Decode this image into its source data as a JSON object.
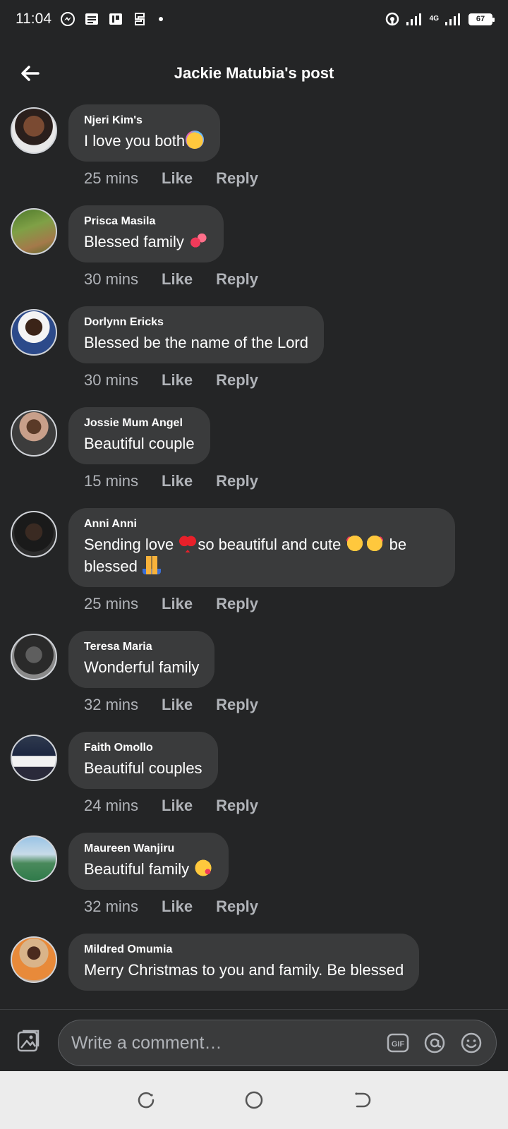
{
  "status_bar": {
    "time": "11:04",
    "network": "4G",
    "battery": "67",
    "icons": [
      "messenger-icon",
      "news-icon",
      "pdf-icon",
      "app-icon",
      "hotspot-icon",
      "signal-icon"
    ]
  },
  "header": {
    "title": "Jackie Matubia's post"
  },
  "comments": [
    {
      "author": "Njeri Kim's",
      "text": "I love you both",
      "emojis": [
        "party-face"
      ],
      "time": "25 mins",
      "like": "Like",
      "reply": "Reply"
    },
    {
      "author": "Prisca Masila",
      "text": "Blessed family ",
      "emojis": [
        "two-hearts"
      ],
      "time": "30 mins",
      "like": "Like",
      "reply": "Reply"
    },
    {
      "author": "Dorlynn Ericks",
      "text": "Blessed be the name of the Lord",
      "emojis": [],
      "time": "30 mins",
      "like": "Like",
      "reply": "Reply"
    },
    {
      "author": "Jossie Mum Angel",
      "text": "Beautiful couple",
      "emojis": [],
      "time": "15 mins",
      "like": "Like",
      "reply": "Reply"
    },
    {
      "author": "Anni Anni",
      "text_line1_a": "Sending love ",
      "text_line1_b": "so beautiful and cute ",
      "text_line1_c": " be",
      "text_line2": "blessed ",
      "time": "25 mins",
      "like": "Like",
      "reply": "Reply"
    },
    {
      "author": "Teresa Maria",
      "text": "Wonderful family",
      "emojis": [],
      "time": "32 mins",
      "like": "Like",
      "reply": "Reply"
    },
    {
      "author": "Faith Omollo",
      "text": "Beautiful couples",
      "emojis": [],
      "time": "24 mins",
      "like": "Like",
      "reply": "Reply"
    },
    {
      "author": "Maureen Wanjiru",
      "text": "Beautiful family ",
      "emojis": [
        "kissing-face"
      ],
      "time": "32 mins",
      "like": "Like",
      "reply": "Reply"
    },
    {
      "author": "Mildred Omumia",
      "text": "Merry Christmas to you and family. Be blessed",
      "emojis": [],
      "time": "",
      "like": "",
      "reply": ""
    }
  ],
  "composer": {
    "placeholder": "Write a comment…",
    "gif_label": "GIF"
  },
  "colors": {
    "background": "#242526",
    "bubble": "#3a3b3c",
    "meta_text": "#b0b3b8",
    "nav_bar": "#ececec"
  }
}
